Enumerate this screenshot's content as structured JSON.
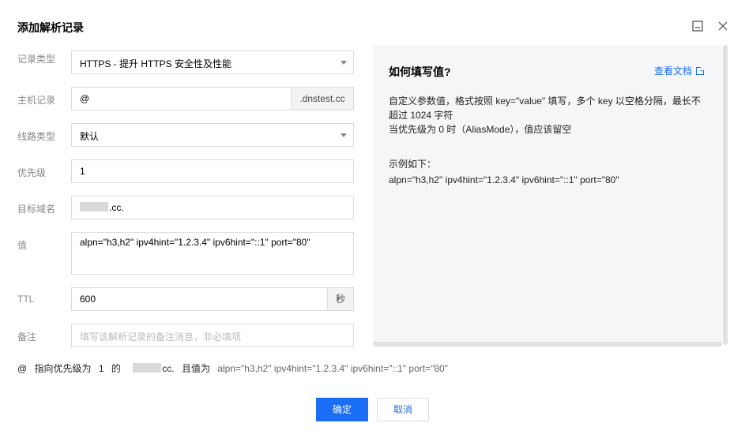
{
  "dialog": {
    "title": "添加解析记录",
    "minimize_icon": "window-minimize-icon",
    "close_icon": "close-icon"
  },
  "form": {
    "record_type": {
      "label": "记录类型",
      "value": "HTTPS - 提升 HTTPS 安全性及性能"
    },
    "host": {
      "label": "主机记录",
      "value": "@",
      "suffix": ".dnstest.cc"
    },
    "line": {
      "label": "线路类型",
      "value": "默认"
    },
    "priority": {
      "label": "优先级",
      "value": "1"
    },
    "target": {
      "label": "目标域名",
      "value": ".cc."
    },
    "value": {
      "label": "值",
      "value": "alpn=\"h3,h2\" ipv4hint=\"1.2.3.4\" ipv6hint=\"::1\" port=\"80\""
    },
    "ttl": {
      "label": "TTL",
      "value": "600",
      "unit": "秒"
    },
    "remark": {
      "label": "备注",
      "placeholder": "填写该解析记录的备注消息，非必填项"
    }
  },
  "help": {
    "title": "如何填写值?",
    "doc_link": "查看文档",
    "line1": "自定义参数值，格式按照 key=\"value\" 填写，多个 key 以空格分隔，最长不",
    "line2": "超过 1024 字符",
    "line3": "当优先级为 0 时（AliasMode），值应该留空",
    "example_title": "示例如下：",
    "example": "alpn=\"h3,h2\" ipv4hint=\"1.2.3.4\" ipv6hint=\"::1\" port=\"80\""
  },
  "preview": {
    "host": "@",
    "part1": "指向优先级为",
    "priority": "1",
    "part2": "的",
    "target": "cc.",
    "part3": "且值为",
    "value": "alpn=\"h3,h2\" ipv4hint=\"1.2.3.4\" ipv6hint=\"::1\" port=\"80\""
  },
  "buttons": {
    "confirm": "确定",
    "cancel": "取消"
  },
  "colors": {
    "primary": "#1a6ef5",
    "border": "#dcdcdc",
    "label": "#888888"
  }
}
